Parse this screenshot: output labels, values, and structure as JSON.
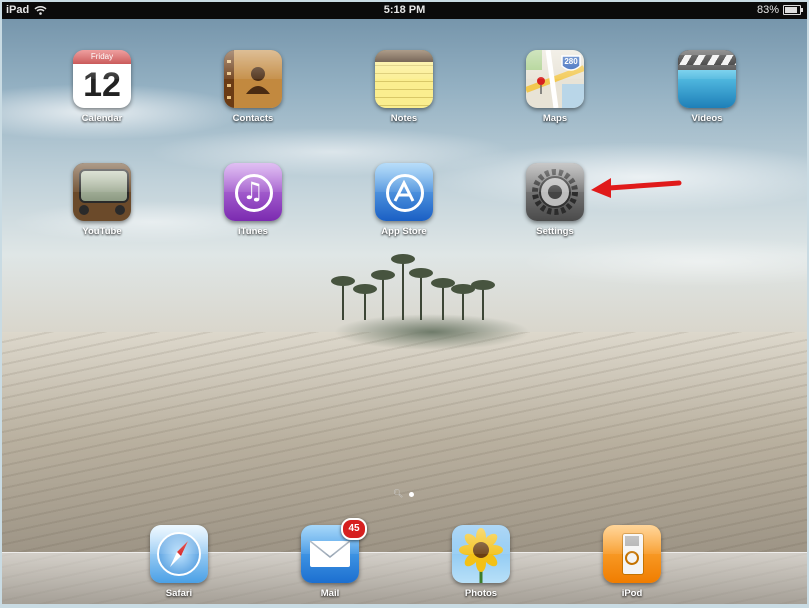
{
  "status_bar": {
    "device": "iPad",
    "time": "5:18 PM",
    "battery": "83%",
    "battery_level": 0.83
  },
  "home_screen": {
    "row1": [
      {
        "label": "Calendar",
        "icon": "calendar-icon",
        "weekday": "Friday",
        "day": "12"
      },
      {
        "label": "Contacts",
        "icon": "contacts-icon"
      },
      {
        "label": "Notes",
        "icon": "notes-icon"
      },
      {
        "label": "Maps",
        "icon": "maps-icon",
        "shield": "280"
      },
      {
        "label": "Videos",
        "icon": "videos-icon"
      }
    ],
    "row2": [
      {
        "label": "YouTube",
        "icon": "youtube-icon"
      },
      {
        "label": "iTunes",
        "icon": "itunes-icon"
      },
      {
        "label": "App Store",
        "icon": "app-store-icon"
      },
      {
        "label": "Settings",
        "icon": "settings-icon"
      }
    ]
  },
  "dock": [
    {
      "label": "Safari",
      "icon": "safari-icon"
    },
    {
      "label": "Mail",
      "icon": "mail-icon",
      "badge": "45"
    },
    {
      "label": "Photos",
      "icon": "photos-icon"
    },
    {
      "label": "iPod",
      "icon": "ipod-icon"
    }
  ],
  "annotation": {
    "icon": "red-arrow-icon",
    "color": "#e01a1a"
  }
}
